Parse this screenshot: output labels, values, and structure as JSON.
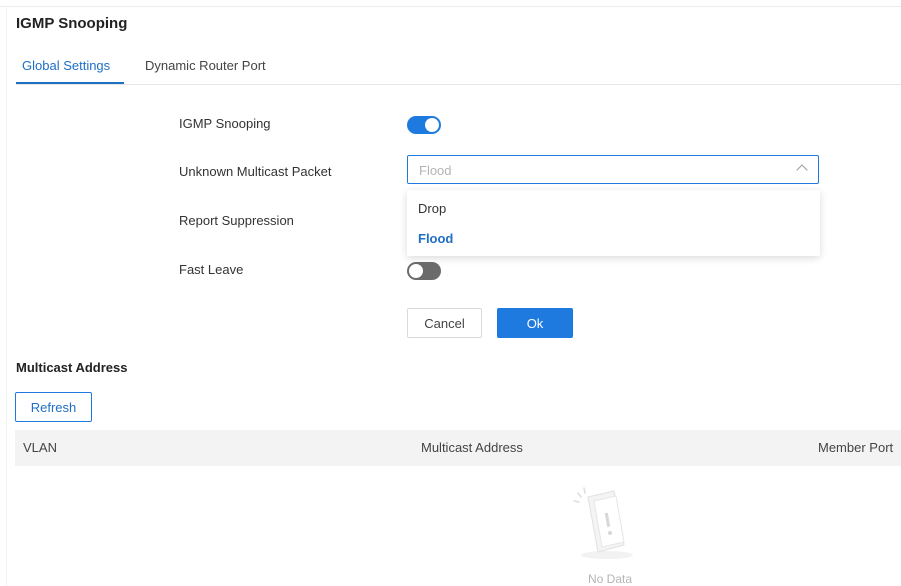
{
  "page": {
    "title": "IGMP Snooping"
  },
  "tabs": [
    {
      "label": "Global Settings",
      "active": true
    },
    {
      "label": "Dynamic Router Port",
      "active": false
    }
  ],
  "form": {
    "igmp_snooping": {
      "label": "IGMP Snooping",
      "enabled": true
    },
    "unknown_multicast": {
      "label": "Unknown Multicast Packet",
      "value": "Flood",
      "options": [
        "Drop",
        "Flood"
      ],
      "dropdown_open": true
    },
    "report_suppression": {
      "label": "Report Suppression"
    },
    "fast_leave": {
      "label": "Fast Leave",
      "enabled": false
    },
    "cancel_label": "Cancel",
    "ok_label": "Ok"
  },
  "multicast": {
    "title": "Multicast Address",
    "refresh_label": "Refresh",
    "columns": [
      "VLAN",
      "Multicast Address",
      "Member Port"
    ],
    "empty_text": "No Data"
  },
  "colors": {
    "accent": "#1f7ae0",
    "toggle_off": "#6b6b6b",
    "header_bg": "#f3f3f3"
  }
}
